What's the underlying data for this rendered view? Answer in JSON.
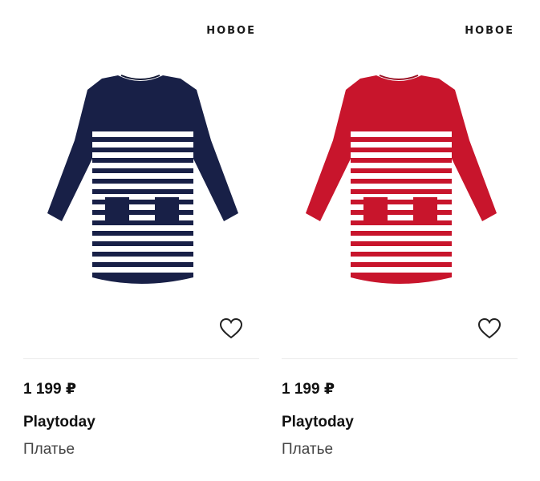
{
  "products": [
    {
      "badge": "НОВОЕ",
      "price": "1 199 ₽",
      "brand": "Playtoday",
      "category": "Платье",
      "image": "navy-white-striped-dress",
      "dress_color": "#182047"
    },
    {
      "badge": "НОВОЕ",
      "price": "1 199 ₽",
      "brand": "Playtoday",
      "category": "Платье",
      "image": "red-white-striped-dress",
      "dress_color": "#c8152c"
    }
  ],
  "icons": {
    "favorite": "heart-outline-icon"
  }
}
